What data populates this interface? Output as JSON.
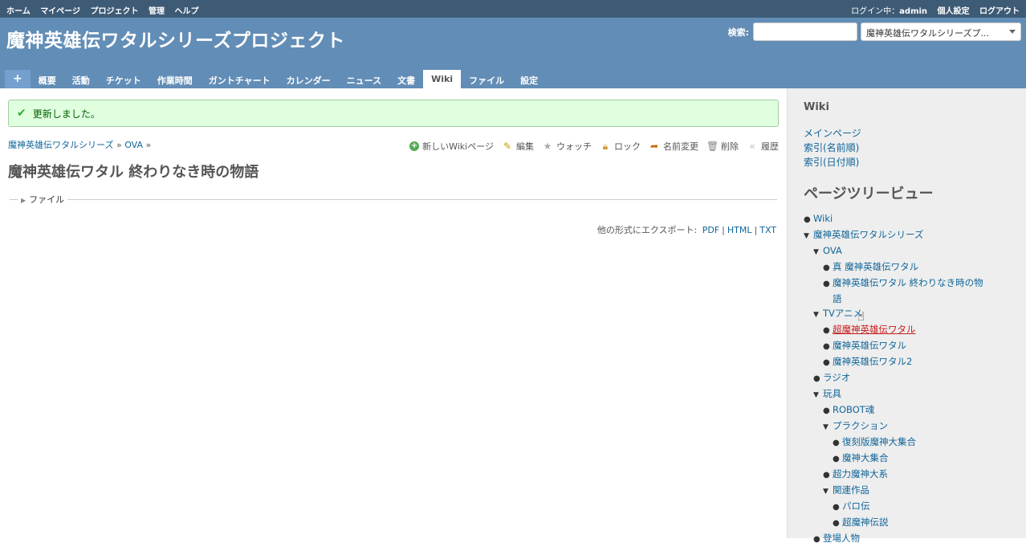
{
  "top_menu": {
    "left": [
      "ホーム",
      "マイページ",
      "プロジェクト",
      "管理",
      "ヘルプ"
    ],
    "logged_in_label": "ログイン中：",
    "user": "admin",
    "my_account": "個人設定",
    "logout": "ログアウト"
  },
  "header": {
    "title": "魔神英雄伝ワタルシリーズプロジェクト",
    "search_label": "検索:",
    "search_value": "",
    "project_jump": "魔神英雄伝ワタルシリーズプ..."
  },
  "main_menu": {
    "new": "+",
    "tabs": [
      "概要",
      "活動",
      "チケット",
      "作業時間",
      "ガントチャート",
      "カレンダー",
      "ニュース",
      "文書",
      "Wiki",
      "ファイル",
      "設定"
    ],
    "selected": "Wiki"
  },
  "flash": {
    "message": "更新しました。"
  },
  "breadcrumb": {
    "parent": "魔神英雄伝ワタルシリーズ",
    "sep1": "»",
    "child": "OVA",
    "sep2": "»"
  },
  "actions": {
    "new_page": "新しいWikiページ",
    "edit": "編集",
    "watch": "ウォッチ",
    "lock": "ロック",
    "rename": "名前変更",
    "delete": "削除",
    "history": "履歴"
  },
  "page": {
    "title": "魔神英雄伝ワタル 終わりなき時の物語",
    "attachments_legend": "ファイル",
    "export_label": "他の形式にエクスポート:",
    "export_pdf": "PDF",
    "export_sep1": "|",
    "export_html": "HTML",
    "export_sep2": "|",
    "export_txt": "TXT"
  },
  "sidebar": {
    "heading": "Wiki",
    "links": [
      "メインページ",
      "索引(名前順)",
      "索引(日付順)"
    ],
    "tree_heading": "ページツリービュー",
    "tree": [
      "Wiki",
      "魔神英雄伝ワタルシリーズ",
      "OVA",
      "真 魔神英雄伝ワタル",
      "魔神英雄伝ワタル 終わりなき時の物",
      "語",
      "TVアニメ",
      "超魔神英雄伝ワタル",
      "魔神英雄伝ワタル",
      "魔神英雄伝ワタル2",
      "ラジオ",
      "玩具",
      "ROBOT魂",
      "プラクション",
      "復刻版魔神大集合",
      "魔神大集合",
      "超力魔神大系",
      "関連作品",
      "パロ伝",
      "超魔神伝説",
      "登場人物"
    ]
  }
}
